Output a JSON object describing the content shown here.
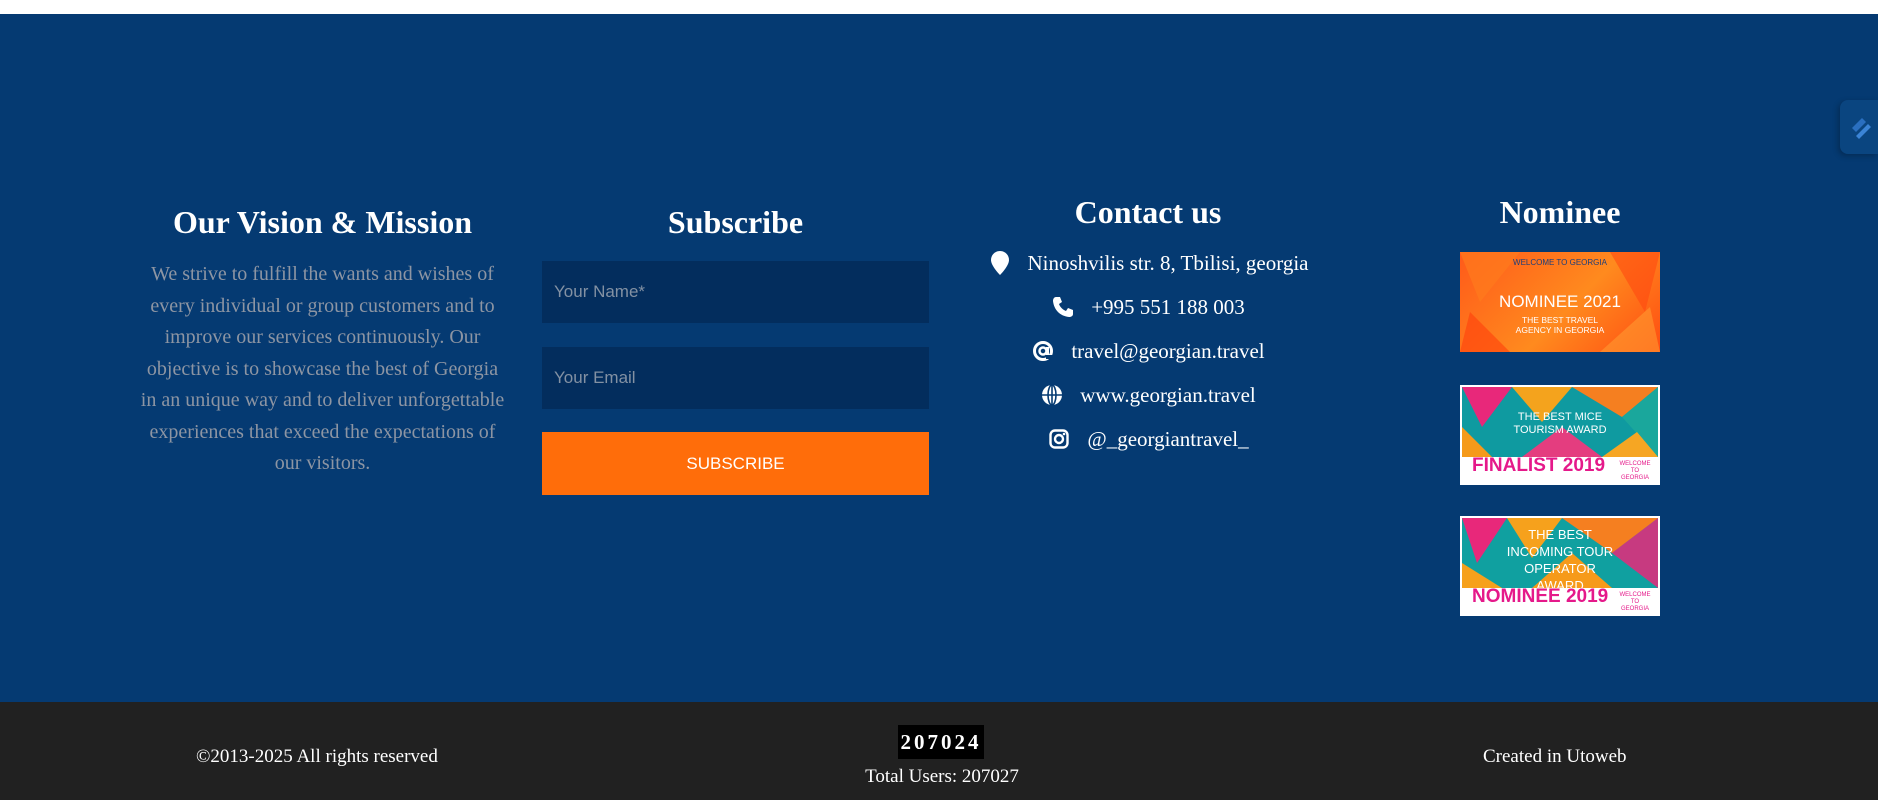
{
  "colors": {
    "footer_bg": "#053a72",
    "input_bg": "#032d5d",
    "button_bg": "#ff6d0a",
    "bottom_bg": "#212121",
    "muted_text": "#8d95a3"
  },
  "vision": {
    "title": "Our Vision & Mission",
    "text": "We strive to fulfill the wants and wishes of every individual or group customers and to improve our services continuously. Our objective is to showcase the best of Georgia in an unique way and to deliver unforgettable experiences that exceed the expectations of our visitors."
  },
  "subscribe": {
    "title": "Subscribe",
    "name_placeholder": "Your Name*",
    "email_placeholder": "Your Email",
    "button_label": "SUBSCRIBE"
  },
  "contact": {
    "title": "Contact us",
    "items": [
      {
        "icon": "location-pin-icon",
        "text": "Ninoshvilis str. 8, Tbilisi, georgia"
      },
      {
        "icon": "phone-icon",
        "text": "+995 551 188 003"
      },
      {
        "icon": "at-sign-icon",
        "text": "travel@georgian.travel"
      },
      {
        "icon": "globe-icon",
        "text": "www.georgian.travel"
      },
      {
        "icon": "instagram-icon",
        "text": "@_georgiantravel_"
      }
    ]
  },
  "nominee": {
    "title": "Nominee",
    "badges": [
      {
        "logo": "WELCOME TO GEORGIA",
        "headline": "NOMINEE 2021",
        "subline": "THE BEST TRAVEL AGENCY IN GEORGIA"
      },
      {
        "award": "THE BEST MICE TOURISM AWARD",
        "ribbon": "FINALIST 2019",
        "logo": "WELCOME TO GEORGIA"
      },
      {
        "award": "THE BEST INCOMING TOUR OPERATOR AWARD",
        "ribbon": "NOMINEE 2019",
        "logo": "WELCOME TO GEORGIA"
      }
    ]
  },
  "footer": {
    "copyright": "©2013-2025 All rights reserved",
    "counter": "207024",
    "total_users": "Total Users: 207027",
    "created": "Created in Utoweb"
  }
}
